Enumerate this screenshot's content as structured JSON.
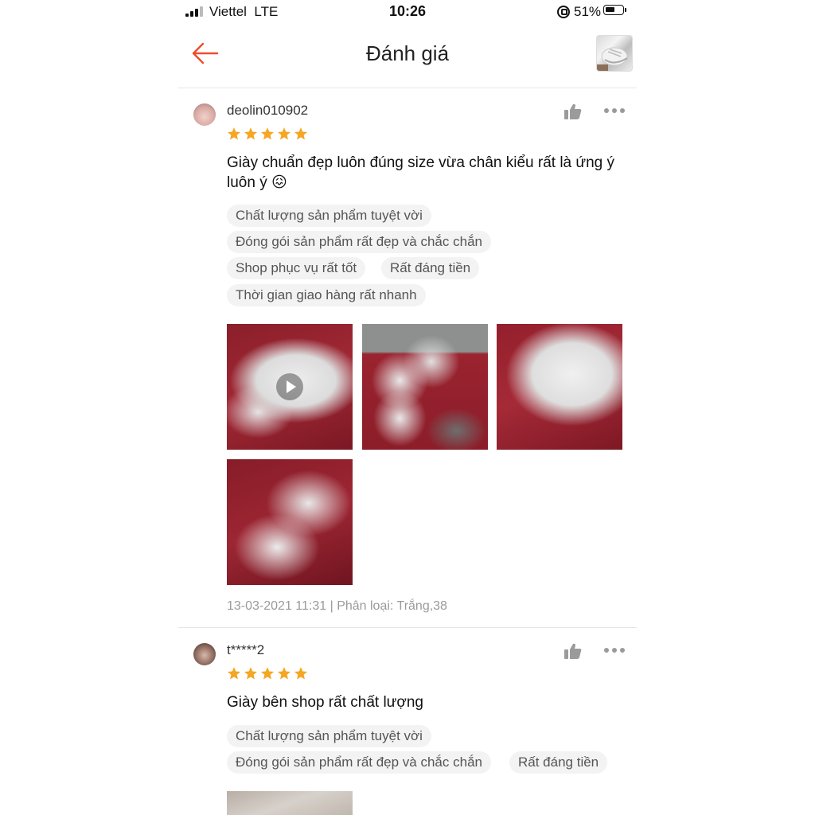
{
  "status_bar": {
    "carrier": "Viettel",
    "network": "LTE",
    "time": "10:26",
    "battery": "51%"
  },
  "header": {
    "title": "Đánh giá"
  },
  "colors": {
    "accent": "#ee4d2d",
    "star": "#f5a623"
  },
  "reviews": [
    {
      "username": "deolin010902",
      "rating": 5,
      "comment": "Giày chuẩn đẹp luôn đúng size vừa chân kiểu rất là ứng ý luôn ý 😖",
      "tags": [
        "Chất lượng sản phẩm tuyệt vời",
        "Đóng gói sản phẩm rất đẹp và chắc chắn",
        "Shop phục vụ rất tốt",
        "Rất đáng tiền",
        "Thời gian giao hàng rất nhanh"
      ],
      "meta": "13-03-2021 11:31 | Phân loại: Trắng,38"
    },
    {
      "username": "t*****2",
      "rating": 5,
      "comment": "Giày bên shop rất chất lượng",
      "tags": [
        "Chất lượng sản phẩm tuyệt vời",
        "Đóng gói sản phẩm rất đẹp và chắc chắn",
        "Rất đáng tiền"
      ]
    }
  ]
}
